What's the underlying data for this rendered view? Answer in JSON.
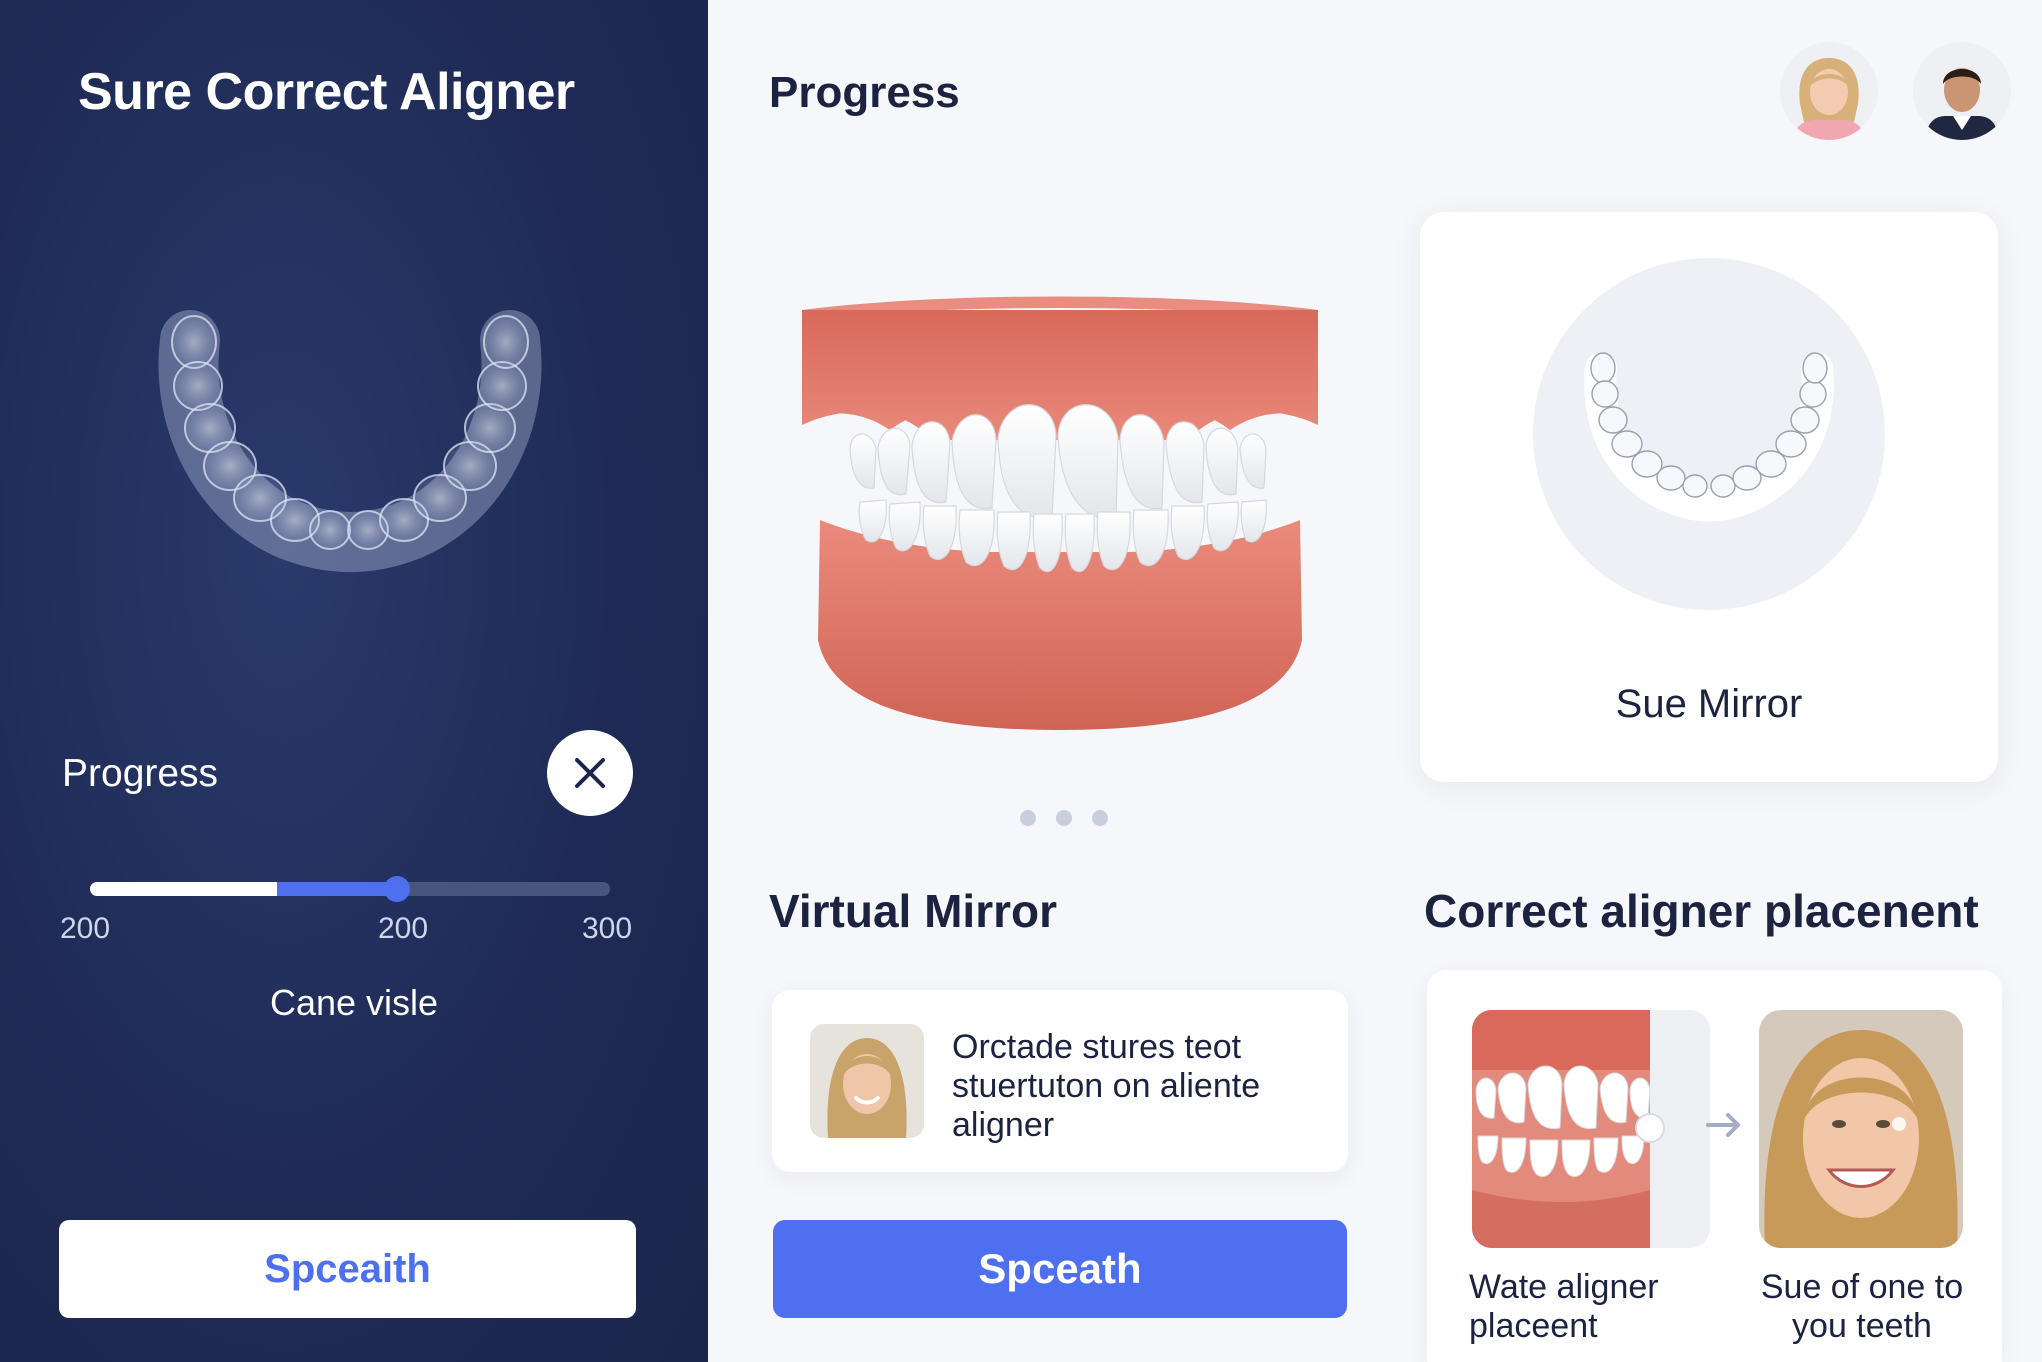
{
  "sidebar": {
    "app_title": "Sure Correct Aligner",
    "progress_label": "Progress",
    "close_icon": "close-icon",
    "slider": {
      "ticks": [
        "200",
        "200",
        "300"
      ],
      "white_fraction": 0.36,
      "value_fraction": 0.59
    },
    "slider_caption": "Cane visle",
    "button_label": "Spceaith"
  },
  "main": {
    "title": "Progress",
    "mirror_card": {
      "label": "Sue Mirror"
    },
    "carousel_dots": 3,
    "virtual_mirror": {
      "heading": "Virtual Mirror",
      "card_text": "Orctade stures teot stuertuton on aliente aligner",
      "button_label": "Spceath"
    },
    "placement": {
      "heading": "Correct aligner placenent",
      "before_label": "Wate aligner placeent",
      "after_label": "Sue of one to you teeth",
      "arrow_icon": "arrow-right-icon"
    }
  },
  "colors": {
    "sidebar_bg": "#1f2b56",
    "accent": "#4d6ff0",
    "gum": "#e27a6c",
    "page_bg": "#f6f7fa"
  }
}
